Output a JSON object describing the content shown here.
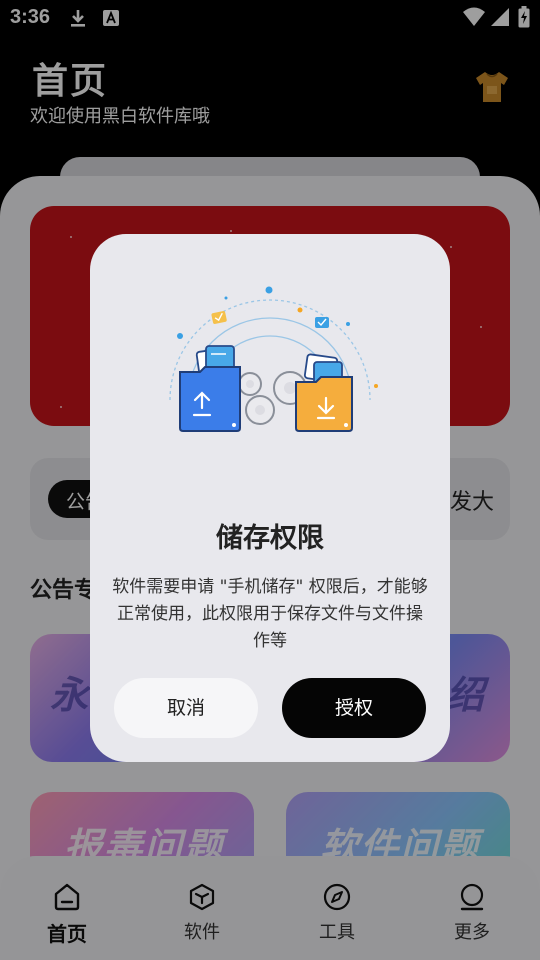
{
  "status_bar": {
    "time": "3:36",
    "icons": [
      "download-icon",
      "a-icon",
      "wifi-icon",
      "signal-icon",
      "battery-icon"
    ]
  },
  "header": {
    "title": "首页",
    "subtitle": "欢迎使用黑白软件库哦",
    "theme_icon": "tshirt-icon"
  },
  "notice": {
    "badge": "公告",
    "text": "发大"
  },
  "section": {
    "title": "公告专区"
  },
  "cards": [
    {
      "label": "永"
    },
    {
      "label": "绍"
    },
    {
      "label": "报毒问题"
    },
    {
      "label": "软件问题"
    }
  ],
  "dialog": {
    "title": "储存权限",
    "body": "软件需要申请 \"手机储存\" 权限后，才能够正常使用，此权限用于保存文件与文件操作等",
    "cancel_label": "取消",
    "confirm_label": "授权"
  },
  "bottom_nav": {
    "items": [
      {
        "label": "首页",
        "icon": "home-icon",
        "active": true
      },
      {
        "label": "软件",
        "icon": "box-icon",
        "active": false
      },
      {
        "label": "工具",
        "icon": "compass-icon",
        "active": false
      },
      {
        "label": "更多",
        "icon": "person-icon",
        "active": false
      }
    ]
  },
  "colors": {
    "banner": "#c7141a",
    "confirm_button": "#050505",
    "dialog_bg": "#e8e8ed"
  }
}
